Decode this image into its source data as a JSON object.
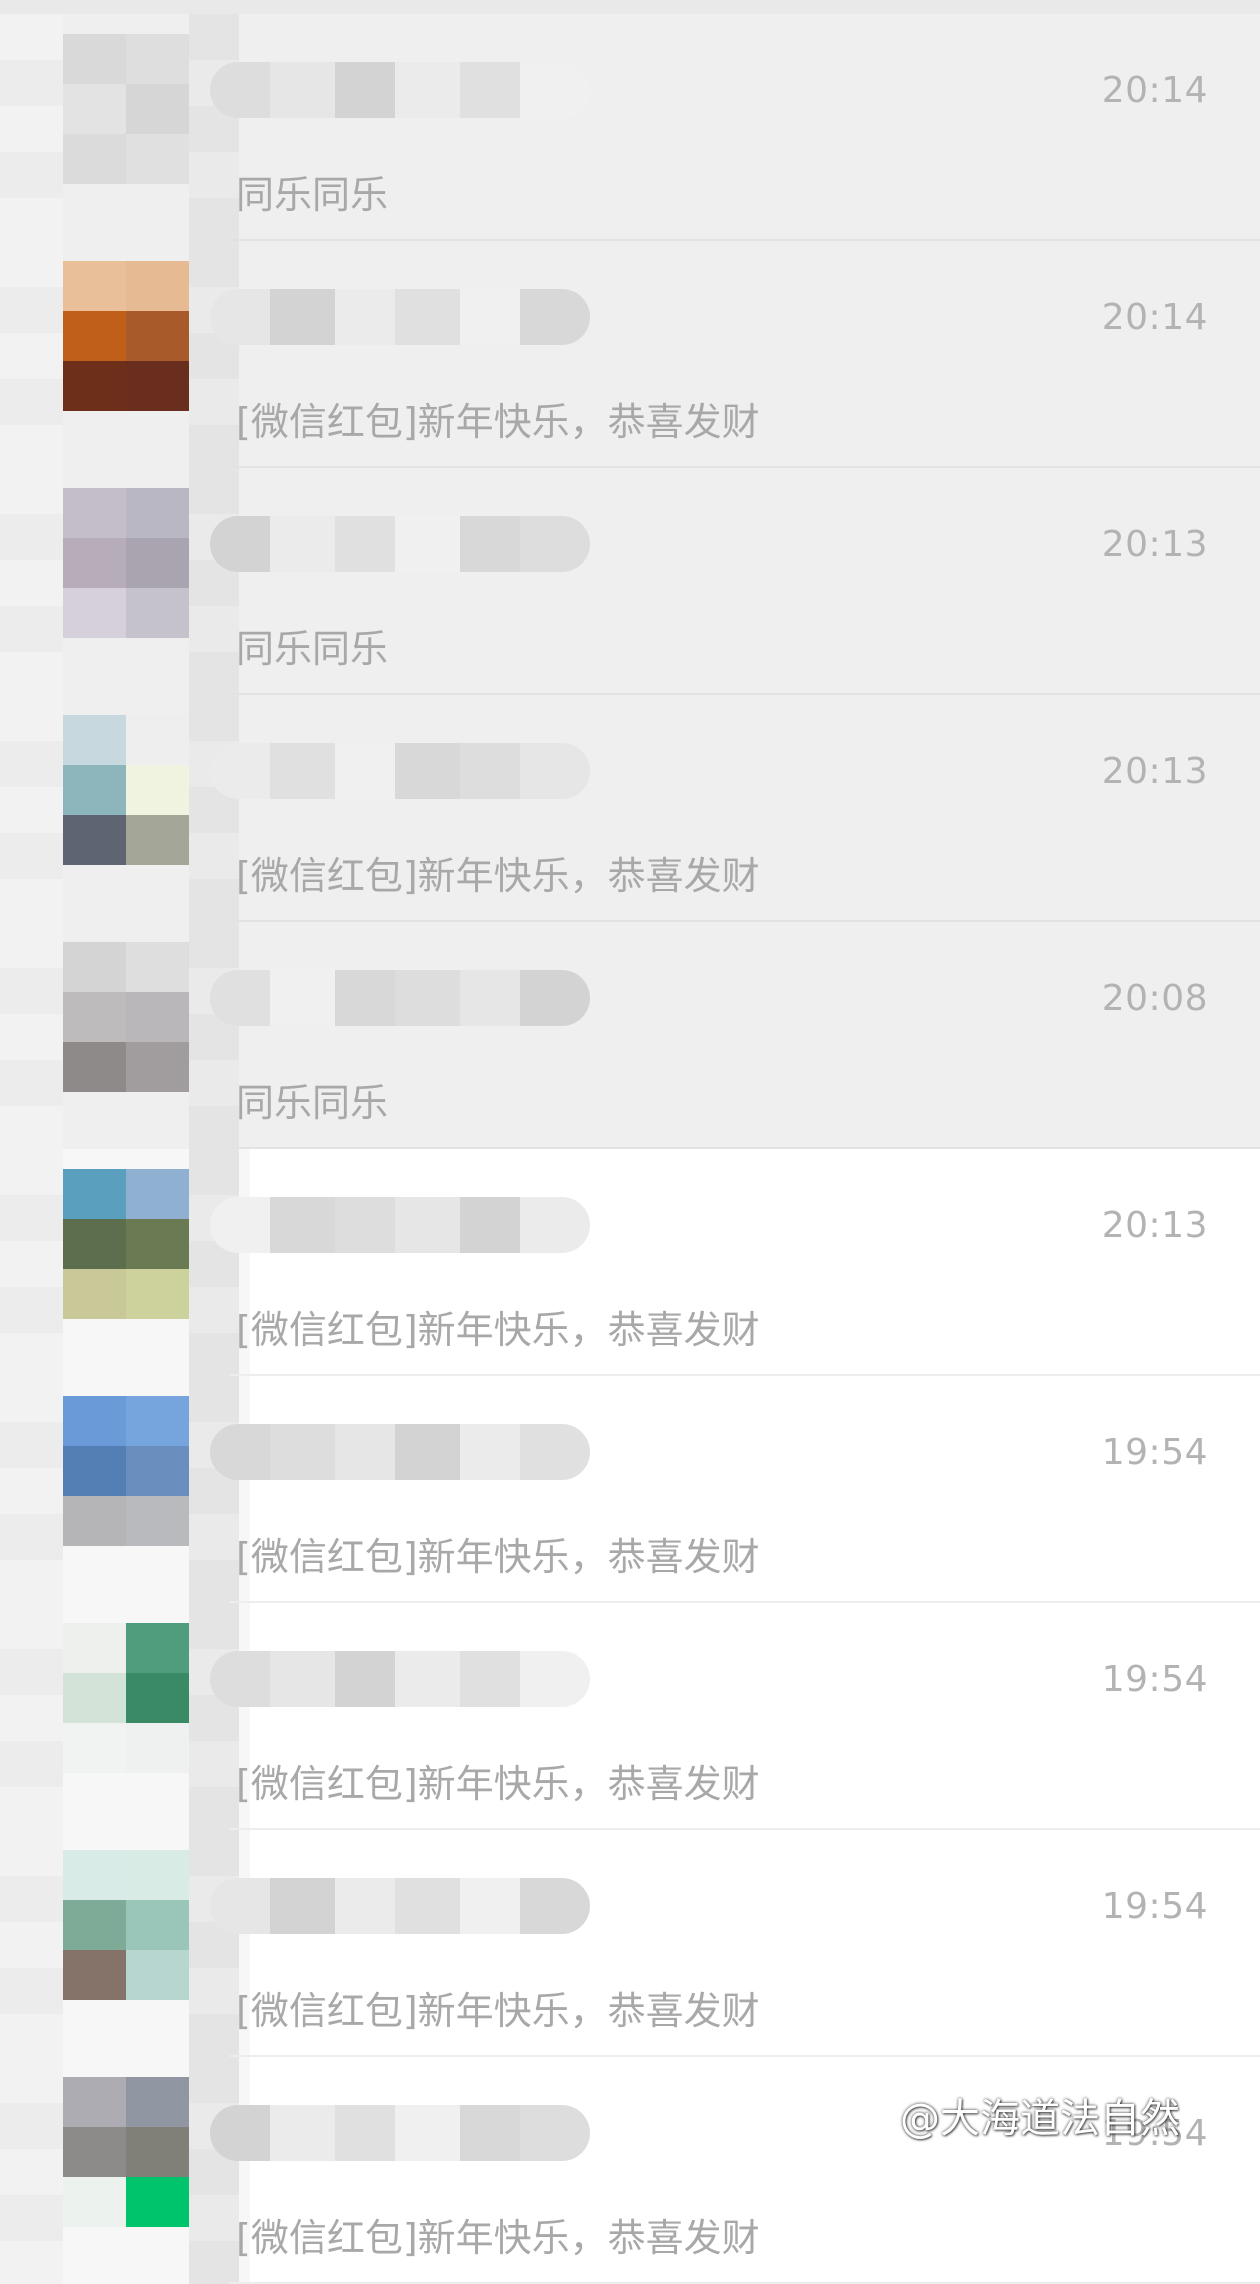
{
  "conversations": [
    {
      "time": "20:14",
      "preview": "同乐同乐",
      "pinned": true,
      "avatar_colors": [
        "#d9d9d9",
        "#dedede",
        "#e3e3e3",
        "#d6d6d6",
        "#dbdbdb",
        "#e0e0e0"
      ]
    },
    {
      "time": "20:14",
      "preview": "[微信红包]新年快乐，恭喜发财",
      "pinned": true,
      "avatar_colors": [
        "#e8bf98",
        "#e6ba92",
        "#bf5f1a",
        "#a85a2a",
        "#6e2f1a",
        "#6a2e1e"
      ]
    },
    {
      "time": "20:13",
      "preview": "同乐同乐",
      "pinned": true,
      "avatar_colors": [
        "#c4bec8",
        "#b9b7c4",
        "#b7adb8",
        "#aaa4b0",
        "#d6d0da",
        "#c6c2cc"
      ]
    },
    {
      "time": "20:13",
      "preview": "[微信红包]新年快乐，恭喜发财",
      "pinned": true,
      "avatar_colors": [
        "#c7d8df",
        "#eeeeee",
        "#8cb6bc",
        "#f0f3e0",
        "#5e6472",
        "#a4a797"
      ]
    },
    {
      "time": "20:08",
      "preview": "同乐同乐",
      "pinned": true,
      "avatar_colors": [
        "#d4d4d4",
        "#dedede",
        "#bdbbbc",
        "#b9b7b9",
        "#8f8a8a",
        "#a19d9e"
      ]
    },
    {
      "time": "20:13",
      "preview": "[微信红包]新年快乐，恭喜发财",
      "pinned": false,
      "avatar_colors": [
        "#5a9fbd",
        "#8fb0d0",
        "#5d6e4f",
        "#6a7a53",
        "#c8c898",
        "#cdd29c"
      ]
    },
    {
      "time": "19:54",
      "preview": "[微信红包]新年快乐，恭喜发财",
      "pinned": false,
      "avatar_colors": [
        "#6a9ad8",
        "#76a4dc",
        "#547fb5",
        "#6a8fbf",
        "#b5b5b8",
        "#b8babe"
      ]
    },
    {
      "time": "19:54",
      "preview": "[微信红包]新年快乐，恭喜发财",
      "pinned": false,
      "avatar_colors": [
        "#eef0ee",
        "#4f9d7d",
        "#d3e3d8",
        "#3a8a66",
        "#f0f3f1",
        "#eef1ef"
      ]
    },
    {
      "time": "19:54",
      "preview": "[微信红包]新年快乐，恭喜发财",
      "pinned": false,
      "avatar_colors": [
        "#d9ebe6",
        "#d8ebe5",
        "#7eab98",
        "#99c6b8",
        "#85736a",
        "#b8d6d0"
      ]
    },
    {
      "time": "19:54",
      "preview": "[微信红包]新年快乐，恭喜发财",
      "pinned": false,
      "avatar_colors": [
        "#acacb2",
        "#9097a3",
        "#8c8b8a",
        "#808079",
        "#ecf2ee",
        "#00c46c"
      ]
    }
  ],
  "watermark": "@大海道法自然"
}
